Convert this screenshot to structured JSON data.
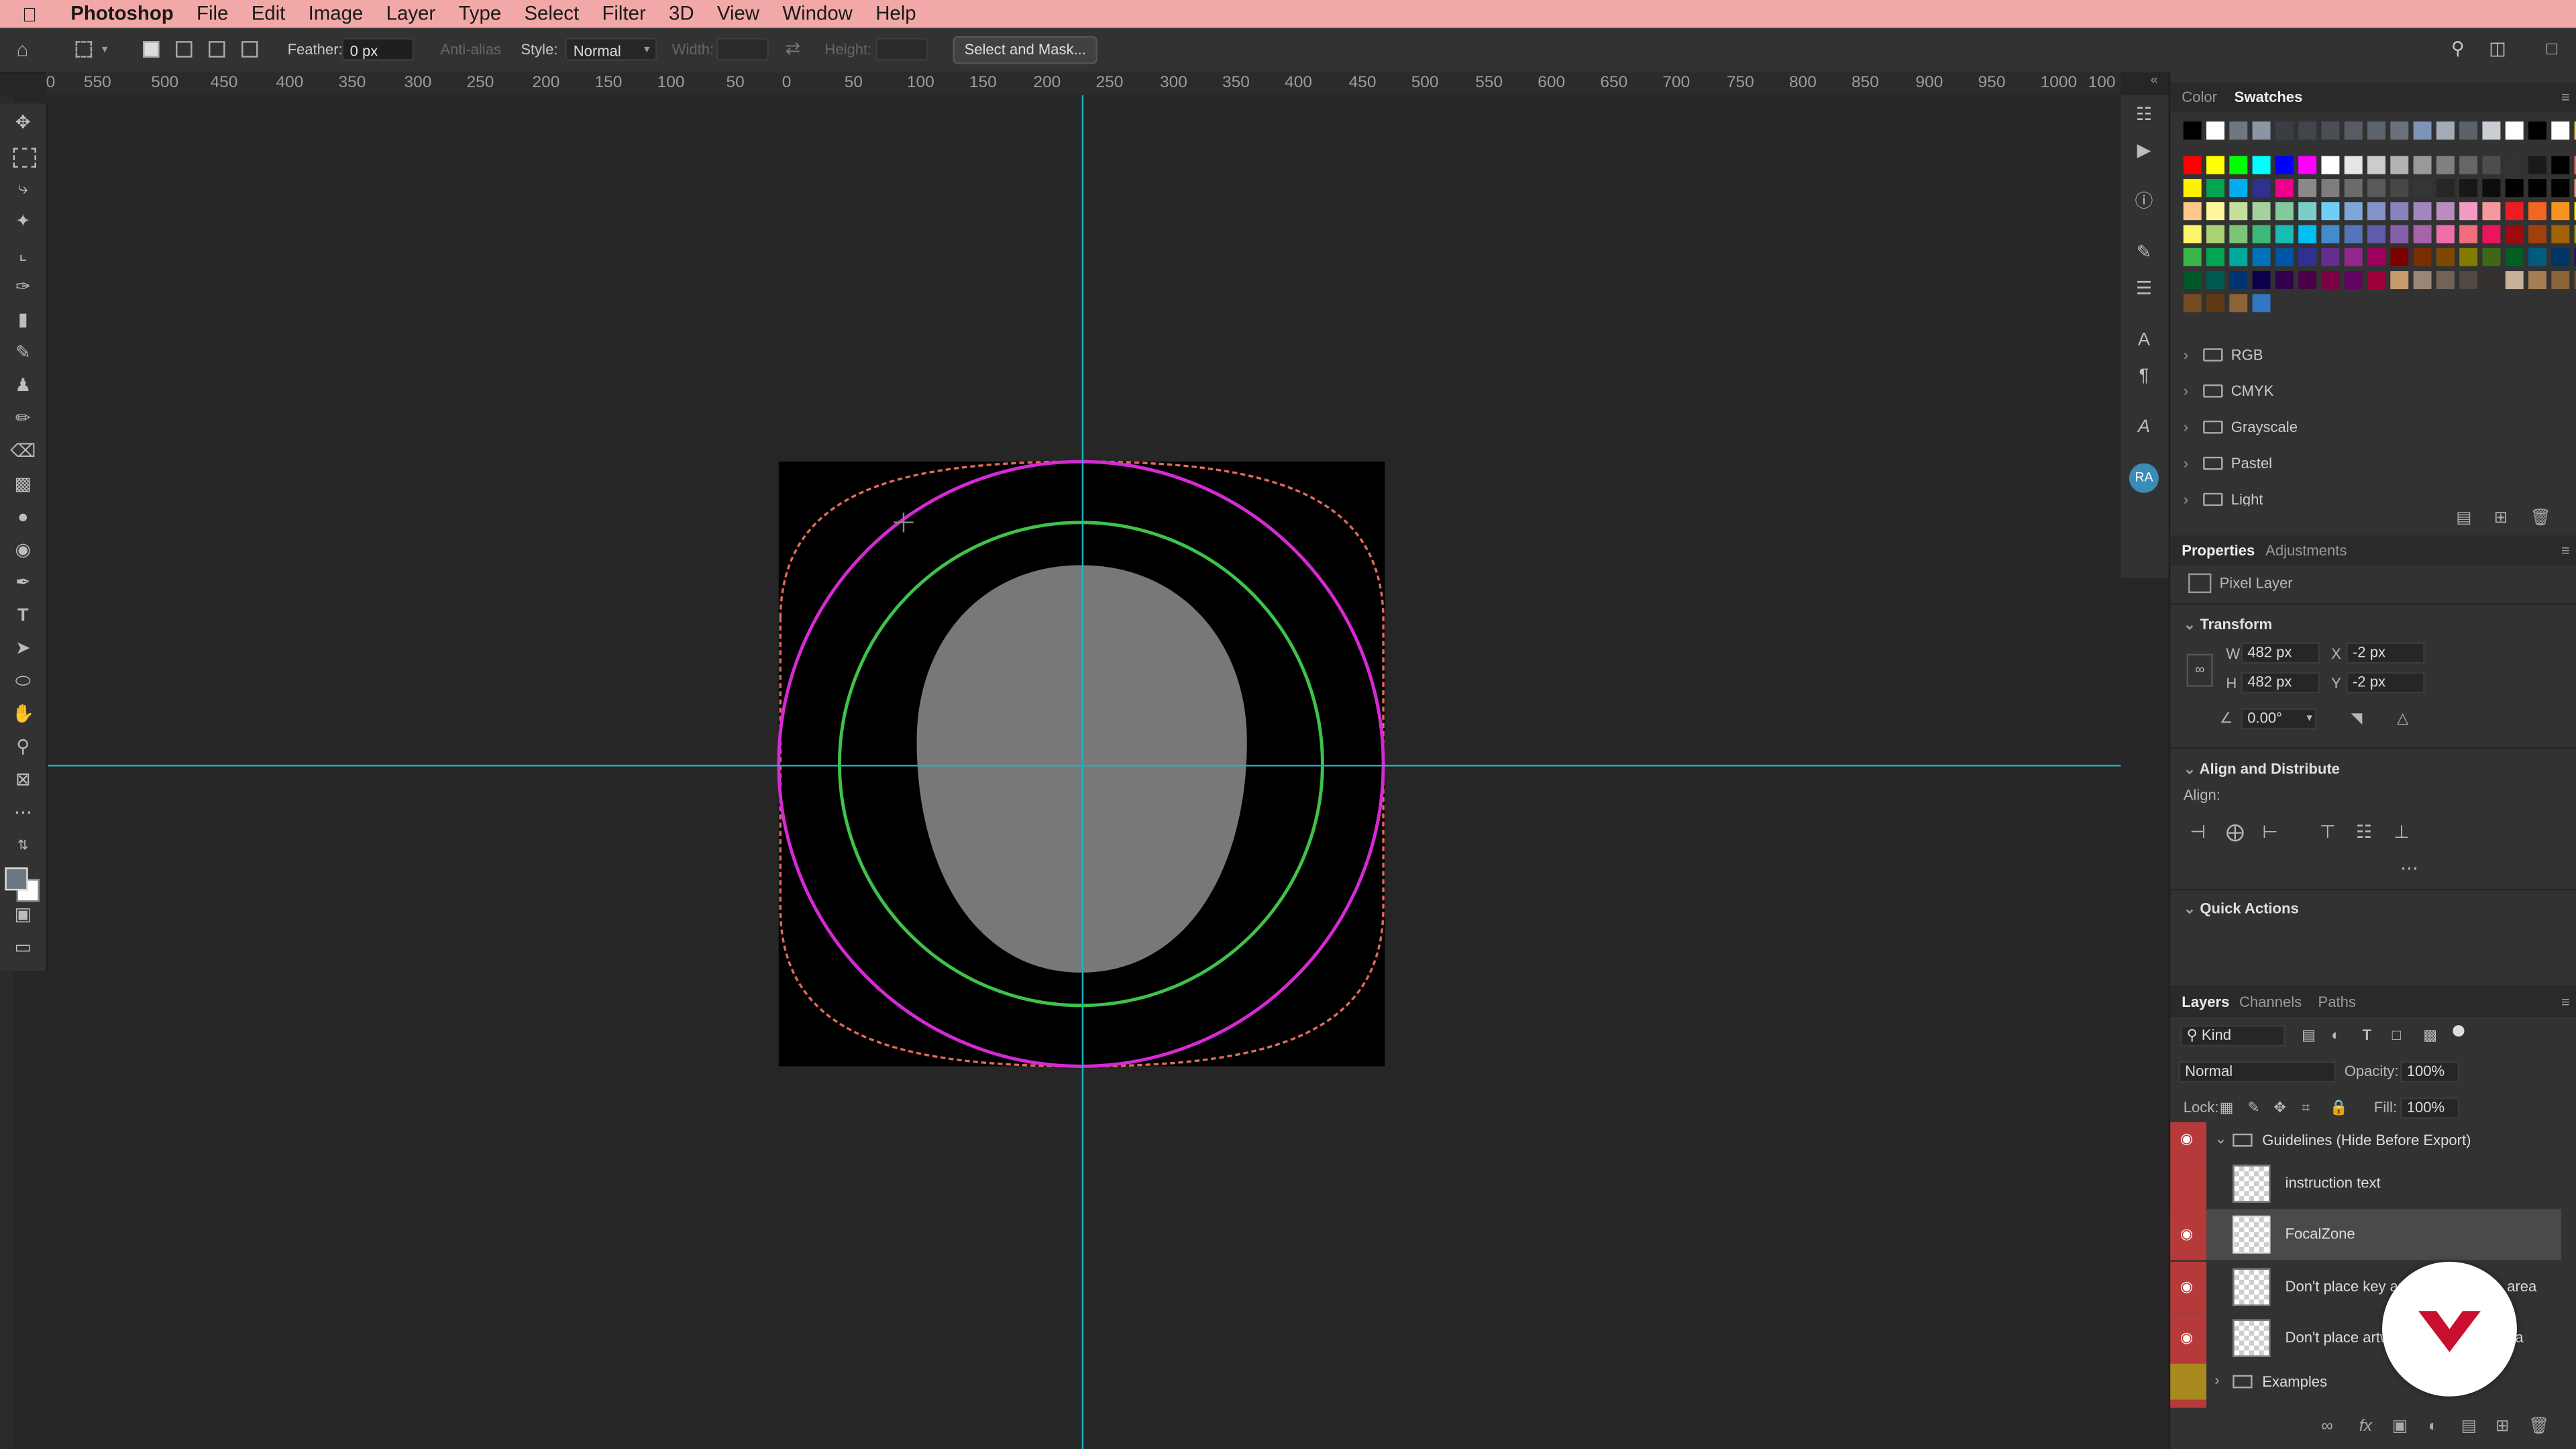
{
  "menubar": {
    "app_name": "Photoshop",
    "items": [
      "File",
      "Edit",
      "Image",
      "Layer",
      "Type",
      "Select",
      "Filter",
      "3D",
      "View",
      "Window",
      "Help"
    ]
  },
  "options_bar": {
    "feather_label": "Feather:",
    "feather_value": "0 px",
    "anti_alias_label": "Anti-alias",
    "style_label": "Style:",
    "style_value": "Normal",
    "width_label": "Width:",
    "height_label": "Height:",
    "select_mask_label": "Select and Mask..."
  },
  "ruler": {
    "labels": [
      "0",
      "550",
      "500",
      "450",
      "400",
      "350",
      "300",
      "250",
      "200",
      "150",
      "100",
      "50",
      "0",
      "50",
      "100",
      "150",
      "200",
      "250",
      "300",
      "350",
      "400",
      "450",
      "500",
      "550",
      "600",
      "650",
      "700",
      "750",
      "800",
      "850",
      "900",
      "950",
      "1000",
      "100"
    ]
  },
  "swatches_panel": {
    "tabs": [
      "Color",
      "Swatches"
    ],
    "active_tab": "Swatches",
    "row0": [
      "#000000",
      "#ffffff",
      "#6f7780",
      "#8a96a4",
      "#3a3e44",
      "#41464d",
      "#4a4f56",
      "#565c63",
      "#5e646c",
      "#6a717a",
      "#7d94b6",
      "#a3abb6",
      "#5c626a",
      "#c9ced4",
      "#ffffff",
      "#000000",
      "#ffffff",
      "#e8c95a",
      "#fff5b0",
      "#ffffff"
    ],
    "row1": [
      "#ff0000",
      "#ffff00",
      "#00ff00",
      "#00ffff",
      "#0000ff",
      "#ff00ff",
      "#ffffff",
      "#e6e6e6",
      "#cccccc",
      "#b3b3b3",
      "#999999",
      "#808080",
      "#666666",
      "#4d4d4d",
      "#333333",
      "#1a1a1a",
      "#000000",
      "#f26c4f",
      "#f68e56"
    ],
    "row2": [
      "#fff200",
      "#00a651",
      "#00aeef",
      "#2e3192",
      "#ec008c",
      "#898989",
      "#7d7d7d",
      "#6b6b6b",
      "#595959",
      "#474747",
      "#363636",
      "#262626",
      "#171717",
      "#0d0d0d",
      "#000000",
      "#000000",
      "#000000",
      "#f7977a",
      "#f9ad81"
    ],
    "row3": [
      "#fdc68a",
      "#fff79a",
      "#c4df9b",
      "#a3d39c",
      "#82ca9d",
      "#7bcdc8",
      "#6ecff6",
      "#7ea7d8",
      "#8493ca",
      "#8882be",
      "#a187be",
      "#bc8cbf",
      "#f49ac2",
      "#f6989d",
      "#ed1c24",
      "#f26522",
      "#f7941d",
      "#fff200",
      "#8dc73f"
    ],
    "row4": [
      "#fff568",
      "#acd373",
      "#7cc576",
      "#3cb878",
      "#1abbb4",
      "#00bff3",
      "#438ccb",
      "#5574b9",
      "#605ca8",
      "#855fa8",
      "#a763a8",
      "#f06eaa",
      "#f26d7d",
      "#ed145b",
      "#9e0b0f",
      "#a0410d",
      "#a36209",
      "#aba000",
      "#598527"
    ],
    "row5": [
      "#39b54a",
      "#00a651",
      "#00a99d",
      "#0072bc",
      "#0054a6",
      "#2e3192",
      "#662d91",
      "#92278f",
      "#9e005d",
      "#790000",
      "#7b2e00",
      "#7d4900",
      "#827b00",
      "#406618",
      "#005e20",
      "#005b7f",
      "#003663",
      "#1b1464",
      "#440e62"
    ],
    "row6": [
      "#005826",
      "#005952",
      "#003471",
      "#0d004c",
      "#32004b",
      "#4b0049",
      "#7b0046",
      "#630460",
      "#9e0039",
      "#c69c6d",
      "#998675",
      "#736357",
      "#534741",
      "#362f2d",
      "#c7b299",
      "#a67c52",
      "#8c6239",
      "#754c24",
      "#603813"
    ],
    "row7": [
      "#754c24",
      "#603813",
      "#8c6239",
      "#3277c2"
    ],
    "folders": [
      "RGB",
      "CMYK",
      "Grayscale",
      "Pastel",
      "Light"
    ]
  },
  "properties_panel": {
    "tabs": [
      "Properties",
      "Adjustments"
    ],
    "active_tab": "Properties",
    "layer_type": "Pixel Layer",
    "transform_label": "Transform",
    "w_label": "W",
    "w_value": "482 px",
    "h_label": "H",
    "h_value": "482 px",
    "x_label": "X",
    "x_value": "-2 px",
    "y_label": "Y",
    "y_value": "-2 px",
    "angle_value": "0.00°",
    "align_section": "Align and Distribute",
    "align_label": "Align:",
    "quick_actions": "Quick Actions"
  },
  "layers_panel": {
    "tabs": [
      "Layers",
      "Channels",
      "Paths"
    ],
    "active_tab": "Layers",
    "filter_kind": "Kind",
    "blend_mode": "Normal",
    "opacity_label": "Opacity:",
    "opacity_value": "100%",
    "lock_label": "Lock:",
    "fill_label": "Fill:",
    "fill_value": "100%",
    "layers": [
      {
        "name": "Guidelines (Hide Before Export)",
        "type": "group",
        "visible": true,
        "expanded": true
      },
      {
        "name": "instruction text",
        "type": "layer",
        "visible": false
      },
      {
        "name": "FocalZone",
        "type": "layer",
        "visible": true,
        "selected": true
      },
      {
        "name": "Don't place key art",
        "trailing": "area",
        "type": "layer",
        "visible": true
      },
      {
        "name": "Don't place artw",
        "trailing": "a",
        "type": "layer",
        "visible": true
      },
      {
        "name": "Examples",
        "type": "group",
        "visible": false,
        "expanded": false
      }
    ]
  },
  "icons": {
    "guide_color": "#1ab2c0",
    "magenta_ring": "#d52ad3",
    "green_ring": "#3fc24a",
    "focal_shape": "#787878",
    "badge_logo_color": "#c8102e"
  }
}
